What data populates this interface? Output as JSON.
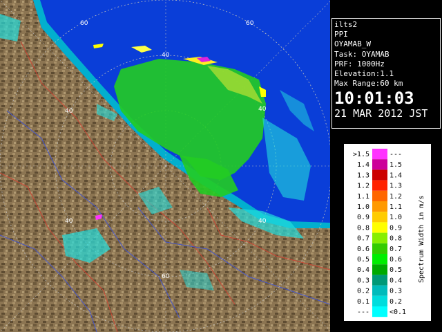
{
  "info": {
    "name": "ilts2",
    "mode": "PPI",
    "site": "OYAMAB_W",
    "task": "Task: OYAMAB",
    "prf": "PRF: 1000Hz",
    "elevation": "Elevation:1.1",
    "max_range": "Max Range:60 km",
    "time": "10:01:03",
    "date": "21 MAR 2012 JST"
  },
  "legend": {
    "title": "Spectrum Width in m/s",
    "rows": [
      {
        "left": ">1.5",
        "right": "---",
        "color": "#ff33ff"
      },
      {
        "left": "1.4",
        "right": "1.5",
        "color": "#cc0099"
      },
      {
        "left": "1.3",
        "right": "1.4",
        "color": "#cc0000"
      },
      {
        "left": "1.2",
        "right": "1.3",
        "color": "#ff2200"
      },
      {
        "left": "1.1",
        "right": "1.2",
        "color": "#ff6600"
      },
      {
        "left": "1.0",
        "right": "1.1",
        "color": "#ff9900"
      },
      {
        "left": "0.9",
        "right": "1.0",
        "color": "#ffcc00"
      },
      {
        "left": "0.8",
        "right": "0.9",
        "color": "#ffff00"
      },
      {
        "left": "0.7",
        "right": "0.8",
        "color": "#88ee00"
      },
      {
        "left": "0.6",
        "right": "0.7",
        "color": "#33cc00"
      },
      {
        "left": "0.5",
        "right": "0.6",
        "color": "#00ee00"
      },
      {
        "left": "0.4",
        "right": "0.5",
        "color": "#00aa00"
      },
      {
        "left": "0.3",
        "right": "0.4",
        "color": "#009977"
      },
      {
        "left": "0.2",
        "right": "0.3",
        "color": "#00bbbb"
      },
      {
        "left": "0.1",
        "right": "0.2",
        "color": "#00dddd"
      },
      {
        "left": "---",
        "right": "<0.1",
        "color": "#00ffff"
      }
    ]
  },
  "range_labels": [
    "60",
    "40",
    "40",
    "40",
    "40",
    "40",
    "60",
    "60"
  ],
  "colors": {
    "sea": "#0a3ed8",
    "land": "#8a7350",
    "echo_main": "#22cc22",
    "echo_weak": "#22dddd"
  }
}
